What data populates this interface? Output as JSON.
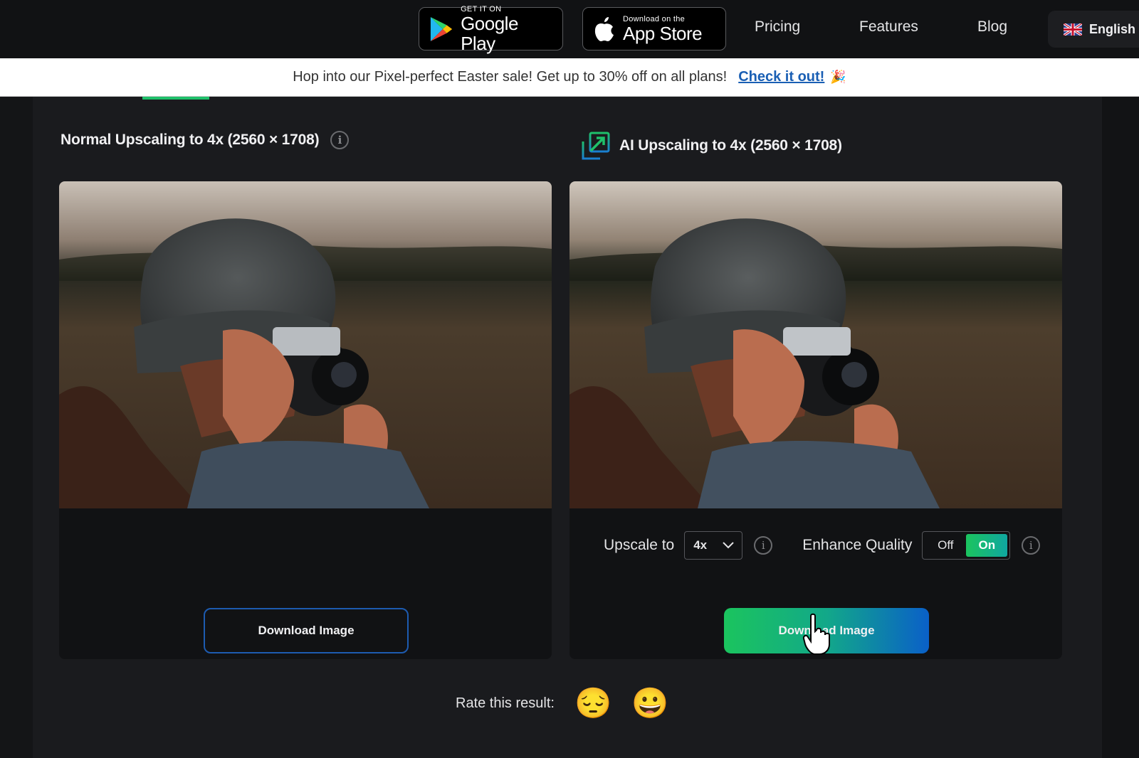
{
  "header": {
    "google_play": {
      "small": "GET IT ON",
      "big": "Google Play"
    },
    "app_store": {
      "small": "Download on the",
      "big": "App Store"
    },
    "nav": [
      "Pricing",
      "Features",
      "Blog"
    ],
    "language": {
      "flag": "uk-flag-icon",
      "label": "English"
    }
  },
  "banner": {
    "text": "Hop into our Pixel-perfect Easter sale! Get up to 30% off on all plans!",
    "cta": "Check it out!",
    "emoji": "🎉"
  },
  "left_panel": {
    "title": "Normal Upscaling to 4x (2560 × 1708)",
    "info_icon": "info-icon",
    "download_label": "Download Image"
  },
  "right_panel": {
    "title": "AI Upscaling to 4x (2560 × 1708)",
    "icon": "upscale-arrow-icon",
    "upscale_label": "Upscale to",
    "upscale_value": "4x",
    "enhance_label": "Enhance Quality",
    "enhance_options": [
      "Off",
      "On"
    ],
    "enhance_selected": "On",
    "download_label": "Download Image"
  },
  "rating": {
    "label": "Rate this result:",
    "options": [
      "😔",
      "😀"
    ]
  },
  "colors": {
    "accent_green": "#1bc45e",
    "accent_blue": "#0a60c8",
    "link_blue": "#1a5fb4"
  }
}
